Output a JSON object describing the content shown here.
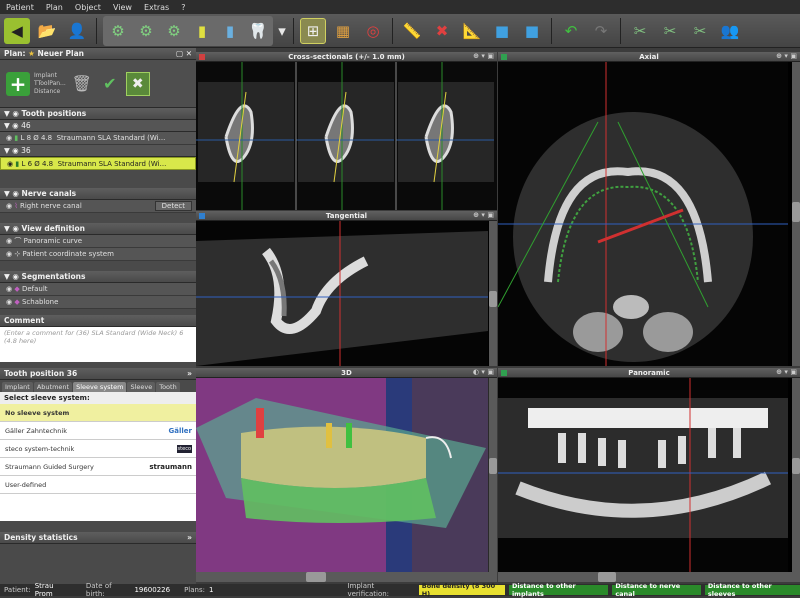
{
  "menu": [
    "Patient",
    "Plan",
    "Object",
    "View",
    "Extras",
    "?"
  ],
  "plan": {
    "label": "Plan:",
    "name": "Neuer Plan",
    "sub": [
      "Implant",
      "TToolPan...",
      "Distance"
    ]
  },
  "sections": {
    "tooth_positions": "Tooth positions",
    "nerve_canals": "Nerve canals",
    "view_definition": "View definition",
    "segmentations": "Segmentations"
  },
  "teeth": [
    {
      "num": "46",
      "l": "L 8",
      "d": "Ø 4.8",
      "name": "Straumann SLA Standard (Wi..."
    },
    {
      "num": "36",
      "l": "L 6",
      "d": "Ø 4.8",
      "name": "Straumann SLA Standard (Wi..."
    }
  ],
  "nerve": {
    "label": "Right nerve canal",
    "button": "Detect"
  },
  "views": [
    "Panoramic curve",
    "Patient coordinate system"
  ],
  "segs": [
    "Default",
    "Schablone"
  ],
  "comment": {
    "title": "Comment",
    "text": "(Enter a comment for (36) SLA Standard (Wide Neck) 6 (4.8 here)"
  },
  "toothpos": {
    "title": "Tooth position 36",
    "tabs": [
      "Implant",
      "Abutment",
      "Sleeve system",
      "Sleeve",
      "Tooth"
    ],
    "active_tab": 2,
    "select_label": "Select sleeve system:"
  },
  "sleeves": [
    {
      "name": "No sleeve system",
      "logo": ""
    },
    {
      "name": "Gäller Zahntechnik",
      "logo": "Gäller"
    },
    {
      "name": "steco system-technik",
      "logo": "steco"
    },
    {
      "name": "Straumann Guided Surgery",
      "logo": "straumann"
    },
    {
      "name": "User-defined",
      "logo": ""
    }
  ],
  "density": "Density statistics",
  "viewports": {
    "cross": "Cross-sectionals (+/- 1.0 mm)",
    "axial": "Axial",
    "tang": "Tangential",
    "three": "3D",
    "pano": "Panoramic"
  },
  "status": {
    "patient_label": "Patient:",
    "patient": "Strau Prom",
    "dob_label": "Date of birth:",
    "dob": "19600226",
    "plans_label": "Plans:",
    "plans": "1",
    "verif_label": "Implant verification:",
    "badges": [
      {
        "text": "Bone density (8 300 H)",
        "color": "#e8e030",
        "fg": "#222"
      },
      {
        "text": "Distance to other implants",
        "color": "#2a8a2a",
        "fg": "#fff"
      },
      {
        "text": "Distance to nerve canal",
        "color": "#2a8a2a",
        "fg": "#fff"
      },
      {
        "text": "Distance to other sleeves",
        "color": "#2a8a2a",
        "fg": "#fff"
      }
    ]
  },
  "colors": {
    "cross_sq": "#d04040",
    "axial_sq": "#30a050",
    "tang_sq": "#3080d0",
    "pano_sq": "#30a050",
    "selected_row": "#d8e84a"
  }
}
